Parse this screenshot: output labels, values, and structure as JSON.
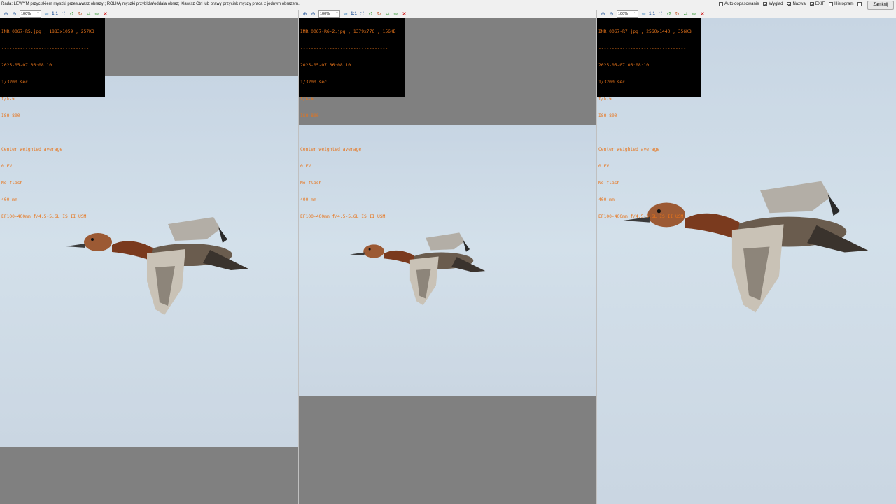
{
  "hint": "Rada: LEWYM przyciskiem myszki przesuwasz obrazy ; ROLKĄ myszki przybliża/oddala obraz; Klawisz Ctrl lub prawy przycisk myszy praca z jednym obrazem.",
  "options": [
    {
      "label": "Auto dopasowanie",
      "checked": false
    },
    {
      "label": "Wygląd",
      "checked": true
    },
    {
      "label": "Nazwa",
      "checked": true
    },
    {
      "label": "EXIF",
      "checked": true
    },
    {
      "label": "Histogram",
      "checked": false
    }
  ],
  "plus_label": "+",
  "close_label": "Zamknij",
  "zoom_value": "100%",
  "ratio_label": "1:1",
  "panels": [
    {
      "header": "IMR_0067-R5.jpg , 1883x1059 , 257KB",
      "separator": "---------------------------------",
      "lines": [
        "2025-05-07 06:08:10",
        "1/3200 sec",
        "f/5.6",
        "ISO 800",
        "",
        "Center weighted average",
        "0 EV",
        "No flash",
        "400 mm",
        "EF100-400mm f/4.5-5.6L IS II USM"
      ]
    },
    {
      "header": "IMR_0067-R6-2.jpg , 1379x776 , 156KB",
      "separator": "---------------------------------",
      "lines": [
        "2025-05-07 06:08:10",
        "1/3200 sec",
        "f/5.6",
        "ISO 800",
        "",
        "Center weighted average",
        "0 EV",
        "No flash",
        "400 mm",
        "EF100-400mm f/4.5-5.6L IS II USM"
      ]
    },
    {
      "header": "IMR_0067-R7.jpg , 2560x1440 , 356KB",
      "separator": "---------------------------------",
      "lines": [
        "2025-05-07 06:08:10",
        "1/3200 sec",
        "f/5.6",
        "ISO 800",
        "",
        "Center weighted average",
        "0 EV",
        "No flash",
        "400 mm",
        "EF100-400mm f/4.5-5.6L IS II USM"
      ]
    }
  ],
  "colors": {
    "exif_text": "#e8741a",
    "exif_bg": "#000000",
    "sky": "#d0dde8",
    "gray": "#808080"
  }
}
